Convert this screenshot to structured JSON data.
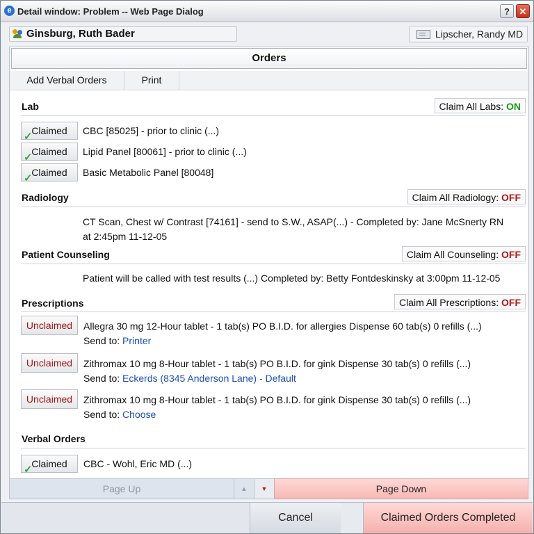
{
  "window": {
    "title": "Detail window: Problem -- Web Page Dialog",
    "help_label": "?",
    "close_label": "✕"
  },
  "header": {
    "patient_name": "Ginsburg, Ruth Bader",
    "provider_name": "Lipscher, Randy MD"
  },
  "orders": {
    "heading": "Orders",
    "toolbar": {
      "add_verbal": "Add Verbal Orders",
      "print": "Print"
    }
  },
  "sections": {
    "lab": {
      "title": "Lab",
      "claim_all_label": "Claim All Labs: ",
      "claim_all_state": "ON",
      "items": [
        {
          "button": "Claimed",
          "text": "CBC [85025] - prior to clinic (...)"
        },
        {
          "button": "Claimed",
          "text": "Lipid Panel [80061] - prior to clinic (...)"
        },
        {
          "button": "Claimed",
          "text": "Basic Metabolic Panel [80048]"
        }
      ]
    },
    "radiology": {
      "title": "Radiology",
      "claim_all_label": "Claim All Radiology: ",
      "claim_all_state": "OFF",
      "items": [
        {
          "line1": "CT Scan, Chest w/ Contrast [74161] - send to S.W., ASAP(...)  - Completed by: Jane McSnerty RN",
          "line2": "at 2:45pm  11-12-05"
        }
      ]
    },
    "counseling": {
      "title": "Patient Counseling",
      "claim_all_label": "Claim All Counseling: ",
      "claim_all_state": "OFF",
      "items": [
        {
          "text": "Patient will be called with test results (...) Completed by: Betty Fontdeskinsky at 3:00pm 11-12-05"
        }
      ]
    },
    "prescriptions": {
      "title": "Prescriptions",
      "claim_all_label": "Claim All Prescriptions: ",
      "claim_all_state": "OFF",
      "send_to_label": "Send to: ",
      "items": [
        {
          "button": "Unclaimed",
          "text": "Allegra 30 mg 12-Hour tablet  -  1 tab(s) PO B.I.D. for allergies  Dispense 60 tab(s) 0 refills  (...)",
          "send_to": "Printer"
        },
        {
          "button": "Unclaimed",
          "text": "Zithromax 10 mg 8-Hour tablet  -  1 tab(s) PO B.I.D. for gink Dispense 30 tab(s) 0 refills  (...)",
          "send_to": "Eckerds (8345 Anderson Lane) - Default"
        },
        {
          "button": "Unclaimed",
          "text": "Zithromax 10 mg 8-Hour tablet  -  1 tab(s) PO B.I.D. for gink Dispense 30 tab(s) 0 refills  (...)",
          "send_to": "Choose"
        }
      ]
    },
    "verbal": {
      "title": "Verbal Orders",
      "items": [
        {
          "button": "Claimed",
          "text": "CBC - Wohl, Eric MD (...)"
        }
      ]
    }
  },
  "pager": {
    "page_up": "Page Up",
    "page_down": "Page Down",
    "arrow_up": "▲",
    "arrow_down": "▼"
  },
  "footer": {
    "cancel": "Cancel",
    "complete": "Claimed Orders Completed"
  },
  "colors": {
    "on": "#179a17",
    "off": "#b01616",
    "unclaimed": "#a31515",
    "link": "#1d4fb8",
    "highlight": "#f7b9b5"
  }
}
